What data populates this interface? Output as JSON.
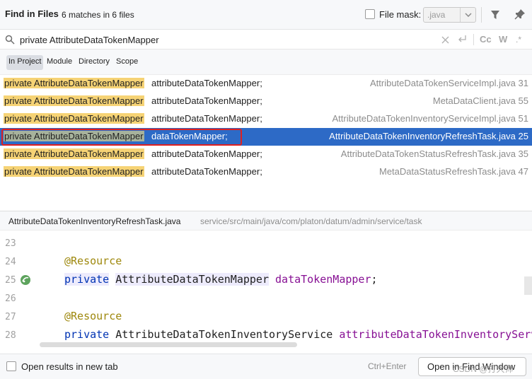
{
  "header": {
    "title": "Find in Files",
    "subtitle": "6 matches in 6 files",
    "file_mask_label": "File mask:",
    "file_mask_value": ".java",
    "filter_icon": "filter-icon",
    "pin_icon": "pin-icon"
  },
  "search": {
    "query": "private AttributeDataTokenMapper",
    "options": {
      "match_case": "Cc",
      "words": "W",
      "regex": ".*"
    }
  },
  "scopes": [
    "In Project",
    "Module",
    "Directory",
    "Scope"
  ],
  "results": [
    {
      "match": "private AttributeDataTokenMapper",
      "rest": "attributeDataTokenMapper;",
      "file": "AttributeDataTokenServiceImpl.java 31",
      "selected": false
    },
    {
      "match": "private AttributeDataTokenMapper",
      "rest": "attributeDataTokenMapper;",
      "file": "MetaDataClient.java 55",
      "selected": false
    },
    {
      "match": "private AttributeDataTokenMapper",
      "rest": "attributeDataTokenMapper;",
      "file": "AttributeDataTokenInventoryServiceImpl.java 51",
      "selected": false
    },
    {
      "match": "private AttributeDataTokenMapper",
      "rest": "dataTokenMapper;",
      "file": "AttributeDataTokenInventoryRefreshTask.java 25",
      "selected": true
    },
    {
      "match": "private AttributeDataTokenMapper",
      "rest": "attributeDataTokenMapper;",
      "file": "AttributeDataTokenStatusRefreshTask.java 35",
      "selected": false
    },
    {
      "match": "private AttributeDataTokenMapper",
      "rest": "attributeDataTokenMapper;",
      "file": "MetaDataStatusRefreshTask.java 47",
      "selected": false
    }
  ],
  "preview": {
    "file_name": "AttributeDataTokenInventoryRefreshTask.java",
    "file_path": "service/src/main/java/com/platon/datum/admin/service/task",
    "lines": [
      {
        "number": "23",
        "annotation": "",
        "keyword": "",
        "type": "",
        "field": ""
      },
      {
        "number": "24",
        "annotation": "@Resource",
        "keyword": "",
        "type": "",
        "field": ""
      },
      {
        "number": "25",
        "annotation": "",
        "keyword": "private",
        "type": "AttributeDataTokenMapper",
        "field": "dataTokenMapper",
        "suffix": ";"
      },
      {
        "number": "26",
        "annotation": "",
        "keyword": "",
        "type": "",
        "field": ""
      },
      {
        "number": "27",
        "annotation": "@Resource",
        "keyword": "",
        "type": "",
        "field": ""
      },
      {
        "number": "28",
        "annotation": "",
        "keyword": "private",
        "type": "AttributeDataTokenInventoryService",
        "field": "attributeDataTokenInventoryServ",
        "suffix": ""
      }
    ]
  },
  "footer": {
    "open_new_tab_label": "Open results in new tab",
    "shortcut": "Ctrl+Enter",
    "open_button": "Open in Find Window",
    "watermark": "CSDN @打大师"
  }
}
